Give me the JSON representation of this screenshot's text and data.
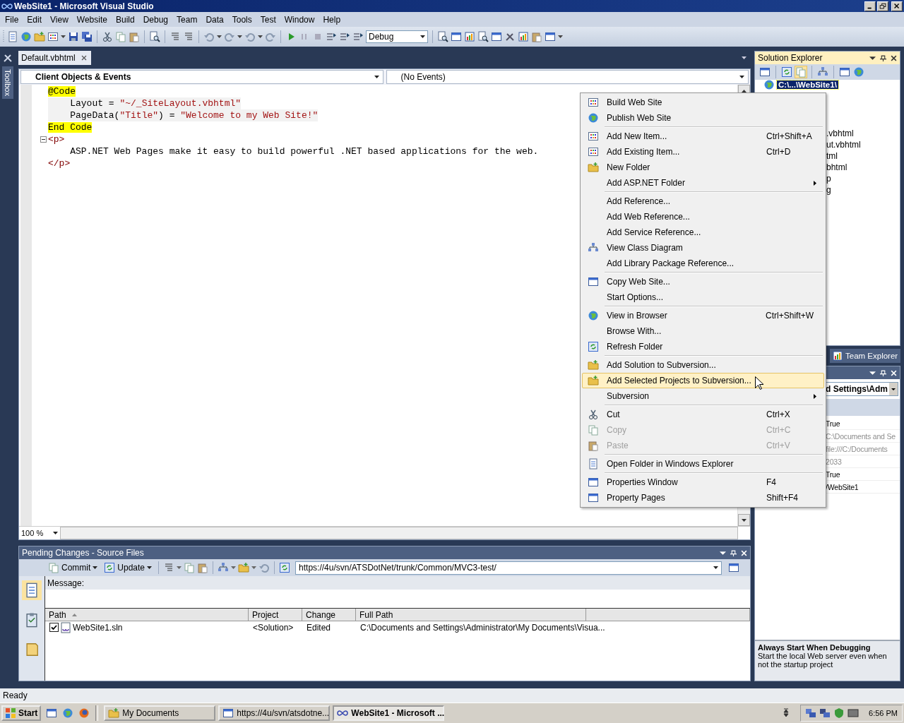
{
  "window": {
    "title": "WebSite1 - Microsoft Visual Studio"
  },
  "menu_bar": [
    "File",
    "Edit",
    "View",
    "Website",
    "Build",
    "Debug",
    "Team",
    "Data",
    "Tools",
    "Test",
    "Window",
    "Help"
  ],
  "toolbar": {
    "configuration": "Debug"
  },
  "toolbox": {
    "label": "Toolbox"
  },
  "editor": {
    "tabs": [
      {
        "label": "Default.vbhtml",
        "selected": true
      }
    ],
    "object_dropdown": "Client Objects & Events",
    "event_dropdown": "(No Events)",
    "zoom": "100 %",
    "lines": [
      {
        "fold": false,
        "block": false,
        "segments": [
          {
            "kind": "razor",
            "text": "@Code"
          }
        ]
      },
      {
        "fold": false,
        "block": true,
        "segments": [
          {
            "kind": "plain",
            "text": "    Layout = "
          },
          {
            "kind": "string",
            "text": "\"~/_SiteLayout.vbhtml\""
          }
        ]
      },
      {
        "fold": false,
        "block": true,
        "segments": [
          {
            "kind": "plain",
            "text": "    PageData("
          },
          {
            "kind": "string",
            "text": "\"Title\""
          },
          {
            "kind": "plain",
            "text": ") = "
          },
          {
            "kind": "string",
            "text": "\"Welcome to my Web Site!\""
          }
        ]
      },
      {
        "fold": false,
        "block": false,
        "segments": [
          {
            "kind": "razor",
            "text": "End Code"
          }
        ]
      },
      {
        "fold": true,
        "block": false,
        "segments": [
          {
            "kind": "tag",
            "text": "<p>"
          }
        ]
      },
      {
        "fold": false,
        "block": false,
        "segments": [
          {
            "kind": "plain",
            "text": "    ASP.NET Web Pages make it easy to build powerful .NET based applications for the web."
          }
        ]
      },
      {
        "fold": false,
        "block": false,
        "segments": [
          {
            "kind": "tag",
            "text": "</p>"
          }
        ]
      }
    ]
  },
  "solution_explorer": {
    "title": "Solution Explorer",
    "root": {
      "label": "C:\\...\\WebSite1\\",
      "selected": true
    },
    "items": [
      ".vbhtml",
      "ut.vbhtml",
      "tml",
      "bhtml",
      "p",
      "g"
    ]
  },
  "team_explorer_tab": "Team Explorer",
  "properties": {
    "object": "d Settings\\Adm",
    "rows": [
      {
        "value": "True",
        "disabled": false
      },
      {
        "value": "C:\\Documents and Se",
        "disabled": true
      },
      {
        "value": "file:///C:/Documents",
        "disabled": true
      },
      {
        "value": "2033",
        "disabled": true
      },
      {
        "value": "True",
        "disabled": false
      },
      {
        "value": "/WebSite1",
        "disabled": false
      }
    ],
    "description": {
      "title": "Always Start When Debugging",
      "text": "Start the local Web server even when not the startup project"
    }
  },
  "context_menu": [
    [
      {
        "label": "Build Web Site",
        "submenu": false,
        "disabled": false,
        "selected": false
      },
      {
        "label": "Publish Web Site",
        "submenu": false,
        "disabled": false,
        "selected": false
      }
    ],
    [
      {
        "label": "Add New Item...",
        "shortcut": "Ctrl+Shift+A",
        "submenu": false,
        "disabled": false,
        "selected": false
      },
      {
        "label": "Add Existing Item...",
        "shortcut": "Ctrl+D",
        "submenu": false,
        "disabled": false,
        "selected": false
      },
      {
        "label": "New Folder",
        "submenu": false,
        "disabled": false,
        "selected": false
      },
      {
        "label": "Add ASP.NET Folder",
        "submenu": true,
        "disabled": false,
        "selected": false
      }
    ],
    [
      {
        "label": "Add Reference...",
        "submenu": false,
        "disabled": false,
        "selected": false
      },
      {
        "label": "Add Web Reference...",
        "submenu": false,
        "disabled": false,
        "selected": false
      },
      {
        "label": "Add Service Reference...",
        "submenu": false,
        "disabled": false,
        "selected": false
      },
      {
        "label": "View Class Diagram",
        "submenu": false,
        "disabled": false,
        "selected": false
      },
      {
        "label": "Add Library Package Reference...",
        "submenu": false,
        "disabled": false,
        "selected": false
      }
    ],
    [
      {
        "label": "Copy Web Site...",
        "submenu": false,
        "disabled": false,
        "selected": false
      },
      {
        "label": "Start Options...",
        "submenu": false,
        "disabled": false,
        "selected": false
      }
    ],
    [
      {
        "label": "View in Browser",
        "shortcut": "Ctrl+Shift+W",
        "submenu": false,
        "disabled": false,
        "selected": false
      },
      {
        "label": "Browse With...",
        "submenu": false,
        "disabled": false,
        "selected": false
      },
      {
        "label": "Refresh Folder",
        "submenu": false,
        "disabled": false,
        "selected": false
      }
    ],
    [
      {
        "label": "Add Solution to Subversion...",
        "submenu": false,
        "disabled": false,
        "selected": false
      },
      {
        "label": "Add Selected Projects to Subversion...",
        "submenu": false,
        "disabled": false,
        "selected": true
      },
      {
        "label": "Subversion",
        "submenu": true,
        "disabled": false,
        "selected": false
      }
    ],
    [
      {
        "label": "Cut",
        "shortcut": "Ctrl+X",
        "submenu": false,
        "disabled": false,
        "selected": false
      },
      {
        "label": "Copy",
        "shortcut": "Ctrl+C",
        "submenu": false,
        "disabled": true,
        "selected": false
      },
      {
        "label": "Paste",
        "shortcut": "Ctrl+V",
        "submenu": false,
        "disabled": true,
        "selected": false
      }
    ],
    [
      {
        "label": "Open Folder in Windows Explorer",
        "submenu": false,
        "disabled": false,
        "selected": false
      }
    ],
    [
      {
        "label": "Properties Window",
        "shortcut": "F4",
        "submenu": false,
        "disabled": false,
        "selected": false
      },
      {
        "label": "Property Pages",
        "shortcut": "Shift+F4",
        "submenu": false,
        "disabled": false,
        "selected": false
      }
    ]
  ],
  "pending_changes": {
    "title": "Pending Changes - Source Files",
    "buttons": [
      "Commit",
      "Update"
    ],
    "url": "https://4u/svn/ATSDotNet/trunk/Common/MVC3-test/",
    "message_label": "Message:",
    "columns": [
      {
        "label": "Path",
        "sorted": true
      },
      {
        "label": "Project",
        "sorted": false
      },
      {
        "label": "Change",
        "sorted": false
      },
      {
        "label": "Full Path",
        "sorted": false
      }
    ],
    "rows": [
      {
        "checked": true,
        "cells": [
          "WebSite1.sln",
          "<Solution>",
          "Edited",
          "C:\\Documents and Settings\\Administrator\\My Documents\\Visua..."
        ]
      }
    ]
  },
  "status_bar": "Ready",
  "taskbar": {
    "start": "Start",
    "tasks": [
      {
        "label": "My Documents",
        "selected": false
      },
      {
        "label": "https://4u/svn/atsdotne...",
        "selected": false
      },
      {
        "label": "WebSite1 - Microsoft ...",
        "selected": true
      }
    ],
    "clock": "6:56 PM"
  }
}
